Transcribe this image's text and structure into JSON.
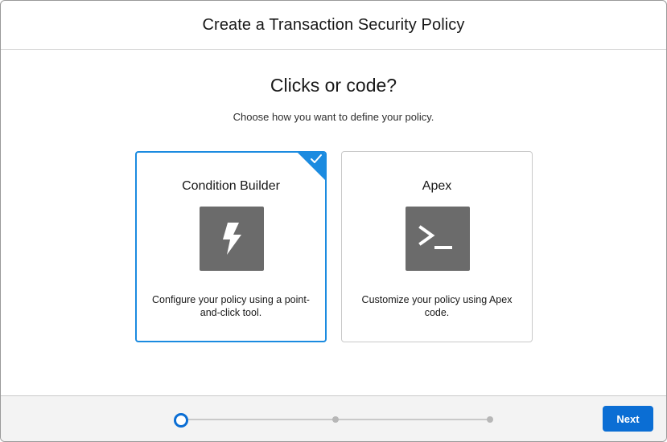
{
  "modal": {
    "title": "Create a Transaction Security Policy"
  },
  "content": {
    "title": "Clicks or code?",
    "subtitle": "Choose how you want to define your policy."
  },
  "options": [
    {
      "title": "Condition Builder",
      "icon": "lightning-bolt-icon",
      "description": "Configure your policy using a point-and-click tool.",
      "selected": true
    },
    {
      "title": "Apex",
      "icon": "terminal-prompt-icon",
      "description": "Customize your policy using Apex code.",
      "selected": false
    }
  ],
  "progress": {
    "current_step": 1,
    "total_steps": 3
  },
  "footer": {
    "next_label": "Next"
  },
  "colors": {
    "brand": "#0b6ed4",
    "selected_border": "#1b8be0",
    "icon_tile": "#6b6b6b",
    "footer_bg": "#f3f3f3"
  }
}
